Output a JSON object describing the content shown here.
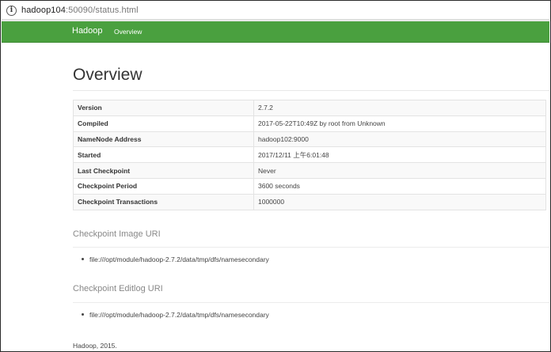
{
  "browser": {
    "url_host": "hadoop104",
    "url_rest": ":50090/status.html",
    "info_glyph": "i"
  },
  "navbar": {
    "brand": "Hadoop",
    "tab_overview": "Overview",
    "color": "#4aa03f"
  },
  "main": {
    "title": "Overview",
    "rows": [
      {
        "key": "Version",
        "value": "2.7.2"
      },
      {
        "key": "Compiled",
        "value": "2017-05-22T10:49Z by root from Unknown"
      },
      {
        "key": "NameNode Address",
        "value": "hadoop102:9000"
      },
      {
        "key": "Started",
        "value": "2017/12/11 上午6:01:48"
      },
      {
        "key": "Last Checkpoint",
        "value": "Never"
      },
      {
        "key": "Checkpoint Period",
        "value": "3600 seconds"
      },
      {
        "key": "Checkpoint Transactions",
        "value": "1000000"
      }
    ],
    "checkpoint_image": {
      "title": "Checkpoint Image URI",
      "items": [
        "file:///opt/module/hadoop-2.7.2/data/tmp/dfs/namesecondary"
      ]
    },
    "checkpoint_editlog": {
      "title": "Checkpoint Editlog URI",
      "items": [
        "file:///opt/module/hadoop-2.7.2/data/tmp/dfs/namesecondary"
      ]
    }
  },
  "footer": {
    "text": "Hadoop, 2015."
  }
}
